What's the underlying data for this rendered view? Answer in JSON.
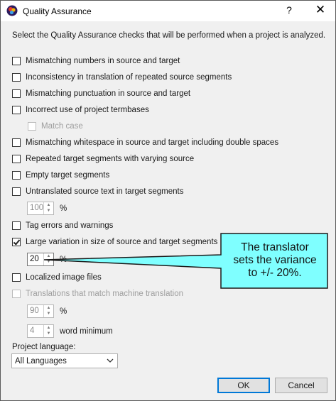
{
  "window": {
    "title": "Quality Assurance",
    "help_glyph": "?",
    "close_glyph": "✕"
  },
  "intro": "Select the Quality Assurance checks that will be performed when a project is analyzed.",
  "checks": [
    {
      "label": "Mismatching numbers in source and target",
      "checked": false,
      "disabled": false
    },
    {
      "label": "Inconsistency in translation of repeated source segments",
      "checked": false,
      "disabled": false
    },
    {
      "label": "Mismatching punctuation in source and target",
      "checked": false,
      "disabled": false
    },
    {
      "label": "Incorrect use of project termbases",
      "checked": false,
      "disabled": false
    },
    {
      "label": "Match case",
      "checked": false,
      "disabled": true
    },
    {
      "label": "Mismatching whitespace in source and target including double spaces",
      "checked": false,
      "disabled": false
    },
    {
      "label": "Repeated target segments with varying source",
      "checked": false,
      "disabled": false
    },
    {
      "label": "Empty target segments",
      "checked": false,
      "disabled": false
    },
    {
      "label": "Untranslated source text in target segments",
      "checked": false,
      "disabled": false
    },
    {
      "label": "Tag errors and warnings",
      "checked": false,
      "disabled": false
    },
    {
      "label": "Large variation in size of source and target segments",
      "checked": true,
      "disabled": false
    },
    {
      "label": "Localized image files",
      "checked": false,
      "disabled": false
    },
    {
      "label": "Translations that match machine translation",
      "checked": false,
      "disabled": true
    }
  ],
  "spinners": {
    "untranslated_pct": {
      "value": "100",
      "unit": "%",
      "enabled": false
    },
    "variation_pct": {
      "value": "20",
      "unit": "%",
      "enabled": true
    },
    "mt_match_pct": {
      "value": "90",
      "unit": "%",
      "enabled": false
    },
    "mt_word_min": {
      "value": "4",
      "unit": "word minimum",
      "enabled": false
    }
  },
  "project_language": {
    "label": "Project language:",
    "selected": "All Languages"
  },
  "buttons": {
    "ok": "OK",
    "cancel": "Cancel"
  },
  "callout": {
    "lines": [
      "The translator",
      "sets the variance",
      "to +/- 20%."
    ],
    "fill": "#7fffff",
    "stroke": "#1a1a1a"
  },
  "colors": {
    "dialog_bg": "#f0f0f0",
    "ok_focus": "#0078d7"
  }
}
